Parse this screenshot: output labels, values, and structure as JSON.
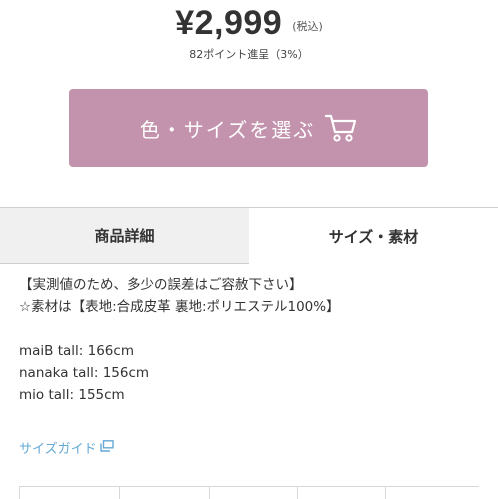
{
  "price": {
    "amount": "¥2,999",
    "tax_note": "(税込)",
    "points": "82ポイント進呈（3%）"
  },
  "select_button": {
    "label": "色・サイズを選ぶ",
    "icon": "cart-icon",
    "color": "#c393ad"
  },
  "tabs": [
    {
      "label": "商品詳細",
      "active": false
    },
    {
      "label": "サイズ・素材",
      "active": true
    }
  ],
  "size_content": {
    "lines": [
      "【実測値のため、多少の誤差はご容赦下さい】",
      "☆素材は【表地:合成皮革 裏地:ポリエステル100%】",
      "",
      "maiB tall: 166cm",
      "nanaka tall: 156cm",
      "mio tall: 155cm"
    ]
  },
  "size_guide": {
    "label": "サイズガイド",
    "icon": "external-window-icon",
    "color": "#66a9d6"
  }
}
